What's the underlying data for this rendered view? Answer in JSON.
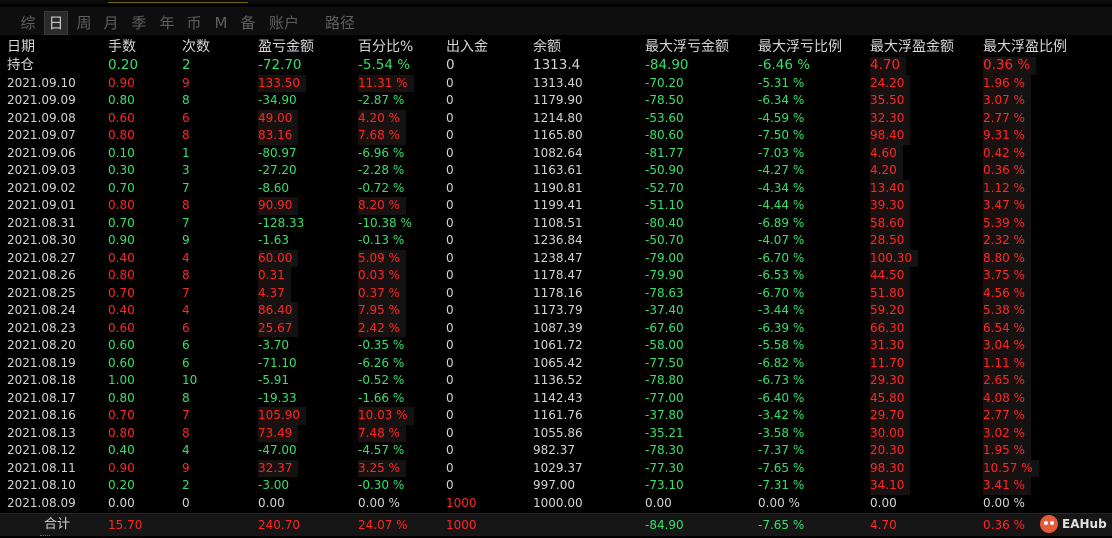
{
  "tabs": [
    {
      "label": "综",
      "active": false
    },
    {
      "label": "日",
      "active": true
    },
    {
      "label": "周",
      "active": false
    },
    {
      "label": "月",
      "active": false
    },
    {
      "label": "季",
      "active": false
    },
    {
      "label": "年",
      "active": false
    },
    {
      "label": "币",
      "active": false
    },
    {
      "label": "M",
      "active": false
    },
    {
      "label": "备",
      "active": false
    },
    {
      "label": "账户",
      "active": false
    },
    {
      "label": "路径",
      "active": false
    }
  ],
  "columns": [
    "日期",
    "手数",
    "次数",
    "盈亏金额",
    "百分比%",
    "出入金",
    "余额",
    "最大浮亏金额",
    "最大浮亏比例",
    "最大浮盈金额",
    "最大浮盈比例"
  ],
  "rows": [
    {
      "date": "持仓",
      "lots": "0.20",
      "count": "2",
      "pnl": "-72.70",
      "pct": "-5.54 %",
      "io": "0",
      "balance": "1313.4",
      "maxloss": "-84.90",
      "maxlosspct": "-6.46 %",
      "maxprofit": "4.70",
      "maxprofitpct": "0.36 %"
    },
    {
      "date": "2021.09.10",
      "lots": "0.90",
      "count": "9",
      "pnl": "133.50",
      "pct": "11.31 %",
      "io": "0",
      "balance": "1313.40",
      "maxloss": "-70.20",
      "maxlosspct": "-5.31 %",
      "maxprofit": "24.20",
      "maxprofitpct": "1.96 %"
    },
    {
      "date": "2021.09.09",
      "lots": "0.80",
      "count": "8",
      "pnl": "-34.90",
      "pct": "-2.87 %",
      "io": "0",
      "balance": "1179.90",
      "maxloss": "-78.50",
      "maxlosspct": "-6.34 %",
      "maxprofit": "35.50",
      "maxprofitpct": "3.07 %"
    },
    {
      "date": "2021.09.08",
      "lots": "0.60",
      "count": "6",
      "pnl": "49.00",
      "pct": "4.20 %",
      "io": "0",
      "balance": "1214.80",
      "maxloss": "-53.60",
      "maxlosspct": "-4.59 %",
      "maxprofit": "32.30",
      "maxprofitpct": "2.77 %"
    },
    {
      "date": "2021.09.07",
      "lots": "0.80",
      "count": "8",
      "pnl": "83.16",
      "pct": "7.68 %",
      "io": "0",
      "balance": "1165.80",
      "maxloss": "-80.60",
      "maxlosspct": "-7.50 %",
      "maxprofit": "98.40",
      "maxprofitpct": "9.31 %"
    },
    {
      "date": "2021.09.06",
      "lots": "0.10",
      "count": "1",
      "pnl": "-80.97",
      "pct": "-6.96 %",
      "io": "0",
      "balance": "1082.64",
      "maxloss": "-81.77",
      "maxlosspct": "-7.03 %",
      "maxprofit": "4.60",
      "maxprofitpct": "0.42 %"
    },
    {
      "date": "2021.09.03",
      "lots": "0.30",
      "count": "3",
      "pnl": "-27.20",
      "pct": "-2.28 %",
      "io": "0",
      "balance": "1163.61",
      "maxloss": "-50.90",
      "maxlosspct": "-4.27 %",
      "maxprofit": "4.20",
      "maxprofitpct": "0.36 %"
    },
    {
      "date": "2021.09.02",
      "lots": "0.70",
      "count": "7",
      "pnl": "-8.60",
      "pct": "-0.72 %",
      "io": "0",
      "balance": "1190.81",
      "maxloss": "-52.70",
      "maxlosspct": "-4.34 %",
      "maxprofit": "13.40",
      "maxprofitpct": "1.12 %"
    },
    {
      "date": "2021.09.01",
      "lots": "0.80",
      "count": "8",
      "pnl": "90.90",
      "pct": "8.20 %",
      "io": "0",
      "balance": "1199.41",
      "maxloss": "-51.10",
      "maxlosspct": "-4.44 %",
      "maxprofit": "39.30",
      "maxprofitpct": "3.47 %"
    },
    {
      "date": "2021.08.31",
      "lots": "0.70",
      "count": "7",
      "pnl": "-128.33",
      "pct": "-10.38 %",
      "io": "0",
      "balance": "1108.51",
      "maxloss": "-80.40",
      "maxlosspct": "-6.89 %",
      "maxprofit": "58.60",
      "maxprofitpct": "5.39 %"
    },
    {
      "date": "2021.08.30",
      "lots": "0.90",
      "count": "9",
      "pnl": "-1.63",
      "pct": "-0.13 %",
      "io": "0",
      "balance": "1236.84",
      "maxloss": "-50.70",
      "maxlosspct": "-4.07 %",
      "maxprofit": "28.50",
      "maxprofitpct": "2.32 %"
    },
    {
      "date": "2021.08.27",
      "lots": "0.40",
      "count": "4",
      "pnl": "60.00",
      "pct": "5.09 %",
      "io": "0",
      "balance": "1238.47",
      "maxloss": "-79.00",
      "maxlosspct": "-6.70 %",
      "maxprofit": "100.30",
      "maxprofitpct": "8.80 %"
    },
    {
      "date": "2021.08.26",
      "lots": "0.80",
      "count": "8",
      "pnl": "0.31",
      "pct": "0.03 %",
      "io": "0",
      "balance": "1178.47",
      "maxloss": "-79.90",
      "maxlosspct": "-6.53 %",
      "maxprofit": "44.50",
      "maxprofitpct": "3.75 %"
    },
    {
      "date": "2021.08.25",
      "lots": "0.70",
      "count": "7",
      "pnl": "4.37",
      "pct": "0.37 %",
      "io": "0",
      "balance": "1178.16",
      "maxloss": "-78.63",
      "maxlosspct": "-6.70 %",
      "maxprofit": "51.80",
      "maxprofitpct": "4.56 %"
    },
    {
      "date": "2021.08.24",
      "lots": "0.40",
      "count": "4",
      "pnl": "86.40",
      "pct": "7.95 %",
      "io": "0",
      "balance": "1173.79",
      "maxloss": "-37.40",
      "maxlosspct": "-3.44 %",
      "maxprofit": "59.20",
      "maxprofitpct": "5.38 %"
    },
    {
      "date": "2021.08.23",
      "lots": "0.60",
      "count": "6",
      "pnl": "25.67",
      "pct": "2.42 %",
      "io": "0",
      "balance": "1087.39",
      "maxloss": "-67.60",
      "maxlosspct": "-6.39 %",
      "maxprofit": "66.30",
      "maxprofitpct": "6.54 %"
    },
    {
      "date": "2021.08.20",
      "lots": "0.60",
      "count": "6",
      "pnl": "-3.70",
      "pct": "-0.35 %",
      "io": "0",
      "balance": "1061.72",
      "maxloss": "-58.00",
      "maxlosspct": "-5.58 %",
      "maxprofit": "31.30",
      "maxprofitpct": "3.04 %"
    },
    {
      "date": "2021.08.19",
      "lots": "0.60",
      "count": "6",
      "pnl": "-71.10",
      "pct": "-6.26 %",
      "io": "0",
      "balance": "1065.42",
      "maxloss": "-77.50",
      "maxlosspct": "-6.82 %",
      "maxprofit": "11.70",
      "maxprofitpct": "1.11 %"
    },
    {
      "date": "2021.08.18",
      "lots": "1.00",
      "count": "10",
      "pnl": "-5.91",
      "pct": "-0.52 %",
      "io": "0",
      "balance": "1136.52",
      "maxloss": "-78.80",
      "maxlosspct": "-6.73 %",
      "maxprofit": "29.30",
      "maxprofitpct": "2.65 %"
    },
    {
      "date": "2021.08.17",
      "lots": "0.80",
      "count": "8",
      "pnl": "-19.33",
      "pct": "-1.66 %",
      "io": "0",
      "balance": "1142.43",
      "maxloss": "-77.00",
      "maxlosspct": "-6.40 %",
      "maxprofit": "45.80",
      "maxprofitpct": "4.08 %"
    },
    {
      "date": "2021.08.16",
      "lots": "0.70",
      "count": "7",
      "pnl": "105.90",
      "pct": "10.03 %",
      "io": "0",
      "balance": "1161.76",
      "maxloss": "-37.80",
      "maxlosspct": "-3.42 %",
      "maxprofit": "29.70",
      "maxprofitpct": "2.77 %"
    },
    {
      "date": "2021.08.13",
      "lots": "0.80",
      "count": "8",
      "pnl": "73.49",
      "pct": "7.48 %",
      "io": "0",
      "balance": "1055.86",
      "maxloss": "-35.21",
      "maxlosspct": "-3.58 %",
      "maxprofit": "30.00",
      "maxprofitpct": "3.02 %"
    },
    {
      "date": "2021.08.12",
      "lots": "0.40",
      "count": "4",
      "pnl": "-47.00",
      "pct": "-4.57 %",
      "io": "0",
      "balance": "982.37",
      "maxloss": "-78.30",
      "maxlosspct": "-7.37 %",
      "maxprofit": "20.30",
      "maxprofitpct": "1.95 %"
    },
    {
      "date": "2021.08.11",
      "lots": "0.90",
      "count": "9",
      "pnl": "32.37",
      "pct": "3.25 %",
      "io": "0",
      "balance": "1029.37",
      "maxloss": "-77.30",
      "maxlosspct": "-7.65 %",
      "maxprofit": "98.30",
      "maxprofitpct": "10.57 %"
    },
    {
      "date": "2021.08.10",
      "lots": "0.20",
      "count": "2",
      "pnl": "-3.00",
      "pct": "-0.30 %",
      "io": "0",
      "balance": "997.00",
      "maxloss": "-73.10",
      "maxlosspct": "-7.31 %",
      "maxprofit": "34.10",
      "maxprofitpct": "3.41 %"
    },
    {
      "date": "2021.08.09",
      "lots": "0.00",
      "count": "0",
      "pnl": "0.00",
      "pct": "0.00 %",
      "io": "1000",
      "balance": "1000.00",
      "maxloss": "0.00",
      "maxlosspct": "0.00 %",
      "maxprofit": "0.00",
      "maxprofitpct": "0.00 %"
    }
  ],
  "totals": {
    "label": "合计",
    "lots": "15.70",
    "count": "",
    "pnl": "240.70",
    "pct": "24.07 %",
    "io": "1000",
    "balance": "",
    "maxloss": "-84.90",
    "maxlosspct": "-7.65 %",
    "maxprofit": "4.70",
    "maxprofitpct": "0.36 %"
  },
  "watermark": {
    "text": "EAHub",
    "icon": "eahub-logo-icon"
  },
  "colors": {
    "positive": "#ff2626",
    "negative": "#35e06a",
    "neutral": "#d4d4d4",
    "background": "#000000"
  }
}
